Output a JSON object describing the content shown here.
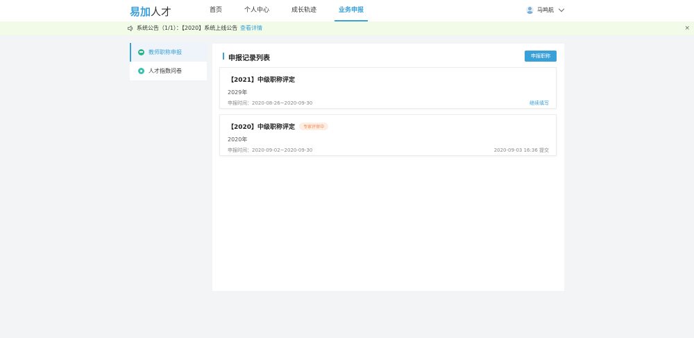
{
  "header": {
    "logo_part1": "易加",
    "logo_part2": "人才",
    "nav": [
      {
        "label": "首页"
      },
      {
        "label": "个人中心"
      },
      {
        "label": "成长轨迹"
      },
      {
        "label": "业务申报"
      }
    ],
    "active_nav": "业务申报",
    "user_name": "马鸣航",
    "accent_color": "#3aa0d8"
  },
  "notice": {
    "text": "系统公告（1/1）：【2020】系统上线公告",
    "link": "查看详情",
    "close": "×"
  },
  "sidebar": {
    "items": [
      {
        "label": "教师职称申报",
        "icon": "graduation-cap-icon",
        "active": true
      },
      {
        "label": "人才指数问卷",
        "icon": "questionnaire-icon",
        "active": false
      }
    ]
  },
  "main": {
    "title": "申报记录列表",
    "apply_button": "申报职称",
    "records": [
      {
        "title": "【2021】中级职称评定",
        "badge": "",
        "year": "2029年",
        "period": "申报时间：2020-08-26~2020-09-30",
        "action": "继续填写",
        "submitted": ""
      },
      {
        "title": "【2020】中级职称评定",
        "badge": "专家评审中",
        "year": "2020年",
        "period": "申报时间：2020-09-02~2020-09-30",
        "action": "",
        "submitted": "2020-09-03 16:36 提交"
      }
    ]
  }
}
